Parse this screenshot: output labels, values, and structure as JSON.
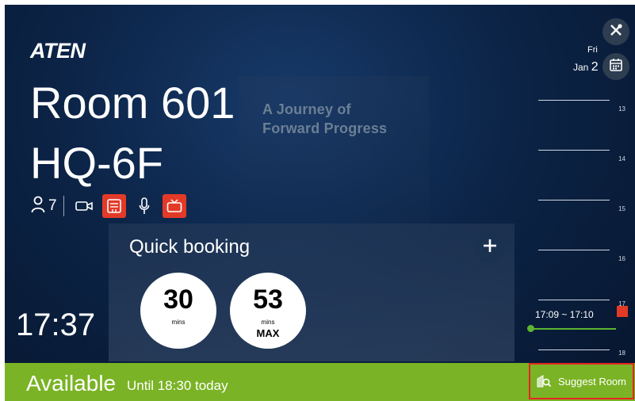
{
  "poster": {
    "line1": "A Journey of",
    "line2": "Forward Progress"
  },
  "brand": {
    "logo": "ATEN"
  },
  "room": {
    "name": "Room 601",
    "location": "HQ-6F",
    "capacity": "7"
  },
  "equipment": [
    {
      "icon": "camera-icon",
      "active": false
    },
    {
      "icon": "whiteboard-icon",
      "active": true
    },
    {
      "icon": "microphone-icon",
      "active": false
    },
    {
      "icon": "tv-icon",
      "active": true
    }
  ],
  "clock": {
    "time": "17:37"
  },
  "date": {
    "day": "Fri",
    "month": "Jan",
    "date": "2"
  },
  "quick_booking": {
    "title": "Quick booking",
    "options": [
      {
        "value": "30",
        "unit": "mins",
        "extra": ""
      },
      {
        "value": "53",
        "unit": "mins",
        "extra": "MAX"
      }
    ]
  },
  "timeline": {
    "hours": [
      "13",
      "14",
      "15",
      "16",
      "17",
      "18"
    ],
    "event": {
      "time": "17:09 ~ 17:10"
    }
  },
  "status": {
    "label": "Available",
    "until": "Until 18:30 today",
    "suggest_label": "Suggest Room"
  },
  "colors": {
    "available": "#7ab325",
    "active_equipment": "#e33a28",
    "highlight": "#e52520"
  }
}
